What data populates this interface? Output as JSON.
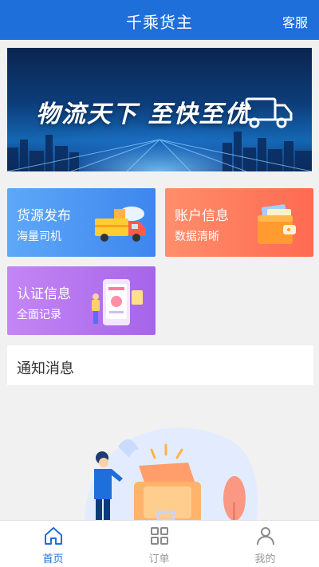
{
  "header": {
    "title": "千乘货主",
    "service_label": "客服"
  },
  "banner": {
    "slogan": "物流天下 至快至优"
  },
  "cards": [
    {
      "title": "货源发布",
      "subtitle": "海量司机",
      "icon": "delivery-truck-icon"
    },
    {
      "title": "账户信息",
      "subtitle": "数据清晰",
      "icon": "wallet-icon"
    },
    {
      "title": "认证信息",
      "subtitle": "全面记录",
      "icon": "certificate-phone-icon"
    }
  ],
  "notice": {
    "label": "通知消息"
  },
  "tabbar": {
    "items": [
      {
        "label": "首页",
        "icon": "home-icon",
        "active": true
      },
      {
        "label": "订单",
        "icon": "grid-icon",
        "active": false
      },
      {
        "label": "我的",
        "icon": "user-icon",
        "active": false
      }
    ]
  },
  "colors": {
    "primary": "#1e6fd9",
    "card_blue": "#4a92f2",
    "card_orange": "#ff7a5e",
    "card_purple": "#b676ef"
  }
}
